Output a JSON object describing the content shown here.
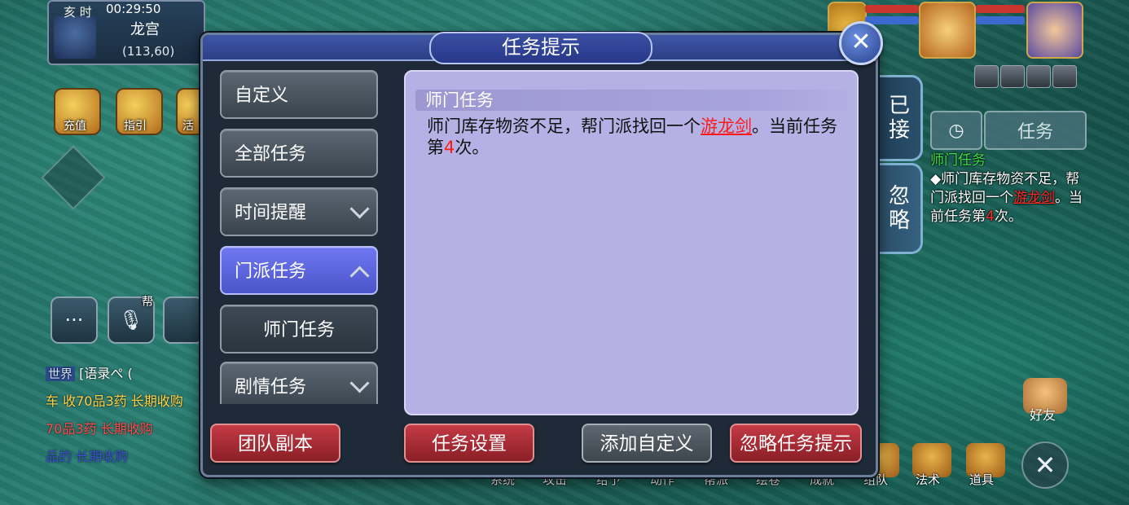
{
  "hud": {
    "time_label": "亥 时",
    "clock": "00:29:50",
    "location": "龙宫",
    "coords": "(113,60)",
    "top_icons": [
      {
        "label": "充值",
        "icon": "recharge-icon"
      },
      {
        "label": "指引",
        "icon": "guide-icon"
      },
      {
        "label": "活",
        "icon": "activity-icon"
      }
    ],
    "chat": {
      "world_tag": "世界",
      "lines": [
        "[语录ぺ (",
        "车 收70品3药 长期收购",
        "70品3药 长期收购",
        "品的 长期收购"
      ]
    },
    "mic_tag": "帮",
    "tracker_button_label": "任务",
    "tracker": {
      "title": "师门任务",
      "text_before": "◆师门库存物资不足，帮门派找回一个",
      "item": "游龙剑",
      "text_after": "。当前任务第",
      "count": "4",
      "text_end": "次。"
    },
    "friend_label": "好友",
    "bottom_menu": [
      "系统",
      "攻击",
      "给予",
      "动作",
      "帮派",
      "绘卷",
      "成就",
      "组队",
      "法术",
      "道具"
    ]
  },
  "side_tabs": {
    "accepted": "已接",
    "ignored": "忽略"
  },
  "dialog": {
    "title": "任务提示",
    "close_symbol": "✕",
    "categories": [
      {
        "label": "自定义",
        "state": "normal"
      },
      {
        "label": "全部任务",
        "state": "normal"
      },
      {
        "label": "时间提醒",
        "state": "collapsed"
      },
      {
        "label": "门派任务",
        "state": "expanded"
      },
      {
        "label": "师门任务",
        "state": "sub"
      },
      {
        "label": "剧情任务",
        "state": "collapsed"
      }
    ],
    "content": {
      "header": "师门任务",
      "text_before": "师门库存物资不足，帮门派找回一个",
      "item": "游龙剑",
      "text_middle": "。当前任务第",
      "count": "4",
      "text_end": "次。"
    },
    "buttons": {
      "team_dungeon": "团队副本",
      "task_settings": "任务设置",
      "add_custom": "添加自定义",
      "ignore_prompt": "忽略任务提示"
    }
  }
}
